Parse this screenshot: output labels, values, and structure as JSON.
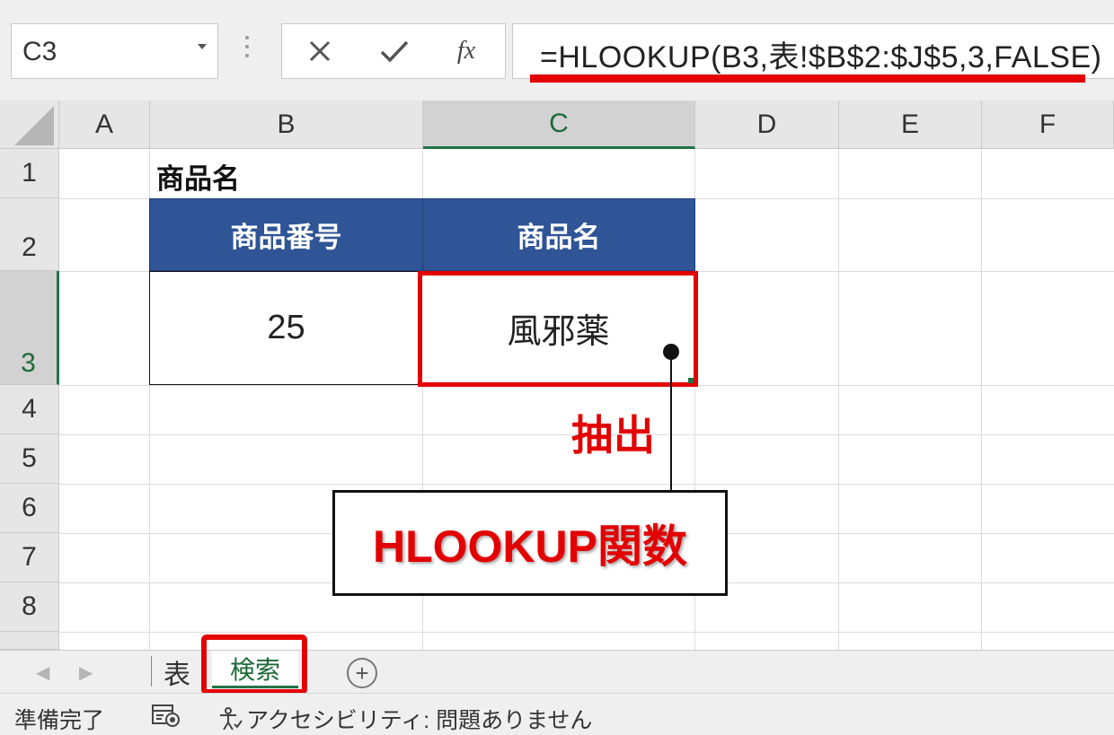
{
  "formula_bar": {
    "name_box": "C3",
    "cancel_icon": "close-icon",
    "enter_icon": "check-icon",
    "fx_label": "fx",
    "formula": "=HLOOKUP(B3,表!$B$2:$J$5,3,FALSE)"
  },
  "grid": {
    "columns": [
      "A",
      "B",
      "C",
      "D",
      "E",
      "F"
    ],
    "rows": [
      "1",
      "2",
      "3",
      "4",
      "5",
      "6",
      "7",
      "8"
    ],
    "selected_column": "C",
    "selected_row": "3",
    "cells": {
      "B1": "商品名",
      "B2": "商品番号",
      "C2": "商品名",
      "B3": "25",
      "C3": "風邪薬"
    },
    "header_fill_color": "#2f5597"
  },
  "annotations": {
    "extract_label": "抽出",
    "callout_label": "HLOOKUP関数",
    "highlight_color": "#e30000"
  },
  "sheet_tabs": {
    "tabs": [
      "表",
      "検索"
    ],
    "active": "検索",
    "add_icon": "plus-circle-icon"
  },
  "status_bar": {
    "ready": "準備完了",
    "accessibility": "アクセシビリティ: 問題ありません"
  }
}
